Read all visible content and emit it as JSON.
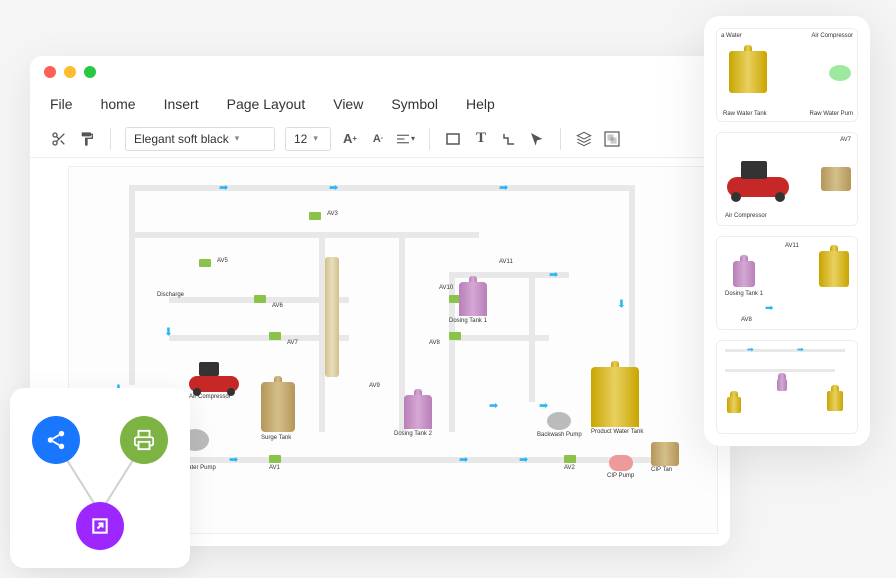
{
  "menu": {
    "file": "File",
    "home": "home",
    "insert": "Insert",
    "page_layout": "Page Layout",
    "view": "View",
    "symbol": "Symbol",
    "help": "Help"
  },
  "toolbar": {
    "font": "Elegant soft black",
    "size": "12"
  },
  "shapes": {
    "raw_water_tank": "Raw Water Tank",
    "raw_water_pump": "Raw Water Pump",
    "air_compressor": "Air Compressor",
    "surge_tank": "Surge Tank",
    "dosing_tank_1": "Dosing Tank 1",
    "dosing_tank_2": "Dosing Tank 2",
    "backwash_pump": "Backwash Pump",
    "product_water_tank": "Product Water Tank",
    "cip_pump": "CIP Pump",
    "cip_tank": "CIP Tan",
    "water": "Water",
    "discharge": "Discharge",
    "av1": "AV1",
    "av2": "AV2",
    "av3": "AV3",
    "av5": "AV5",
    "av6": "AV6",
    "av7": "AV7",
    "av8": "AV8",
    "av9": "AV9",
    "av10": "AV10",
    "av11": "AV11"
  },
  "thumbs": {
    "t1_label1": "Raw Water Tank",
    "t1_label2": "Raw Water Pum",
    "t1_top1": "a Water",
    "t1_top2": "Air Compressor",
    "t2_label": "Air Compressor",
    "t2_av": "AV7",
    "t3_dosing": "Dosing Tank 1",
    "t3_av8": "AV8",
    "t3_av11": "AV11"
  }
}
